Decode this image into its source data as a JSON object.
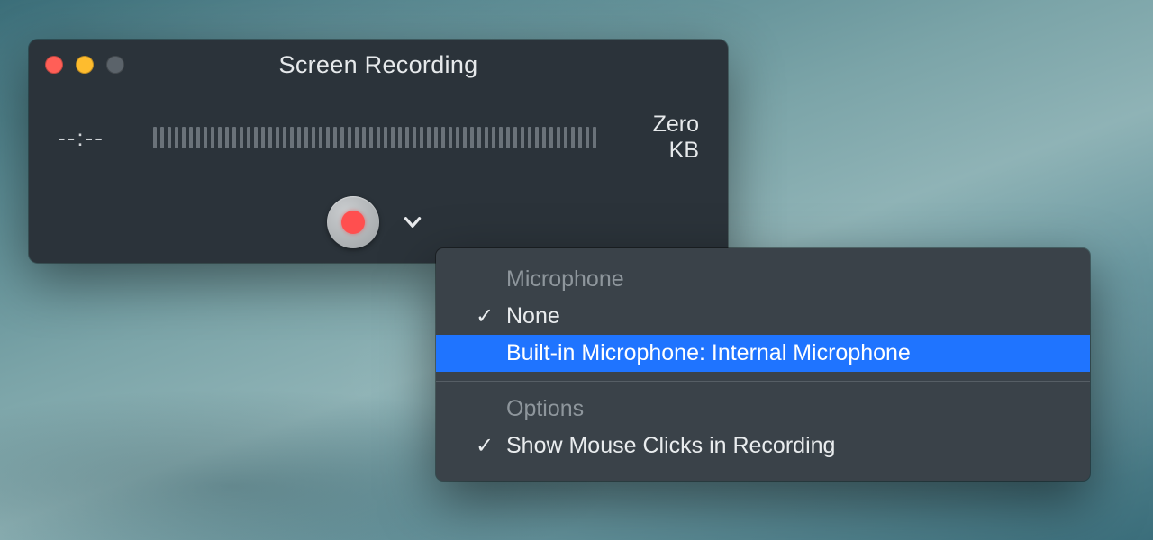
{
  "window": {
    "title": "Screen Recording",
    "elapsed": "--:--",
    "filesize": "Zero KB"
  },
  "menu": {
    "section_microphone": "Microphone",
    "item_none": "None",
    "item_builtin": "Built-in Microphone: Internal Microphone",
    "section_options": "Options",
    "item_showclicks": "Show Mouse Clicks in Recording",
    "checkmark": "✓"
  }
}
